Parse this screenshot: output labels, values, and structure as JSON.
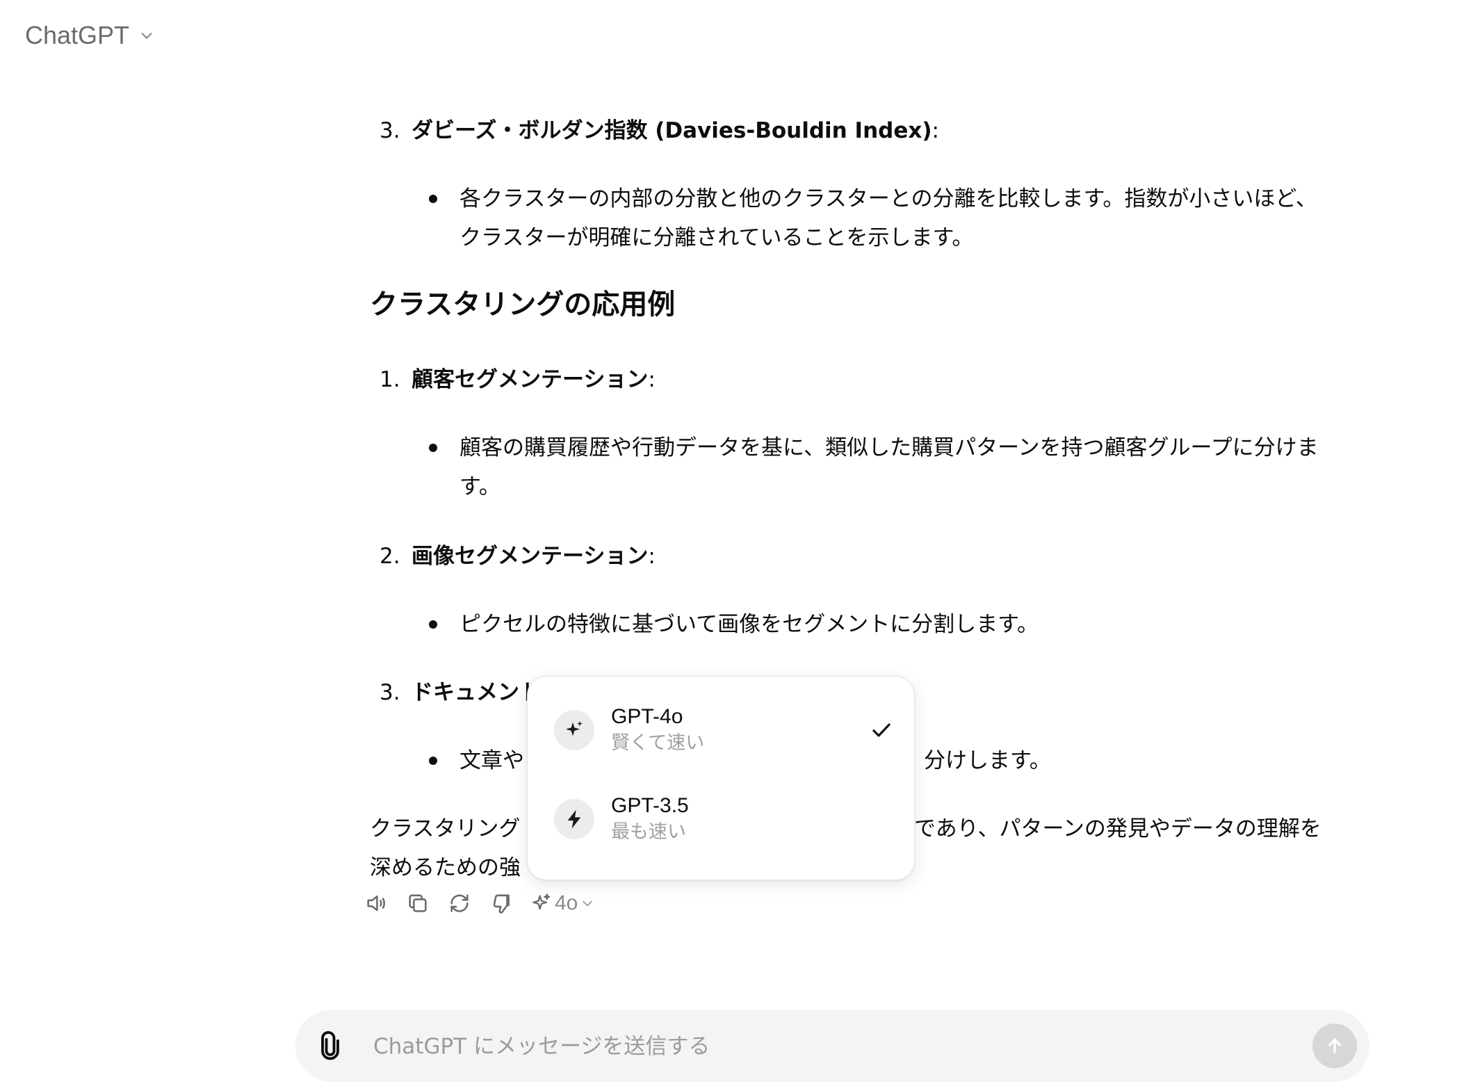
{
  "header": {
    "title": "ChatGPT"
  },
  "message": {
    "item_eval_3": {
      "num": "3.",
      "title": "ダビーズ・ボルダン指数 (Davies-Bouldin Index)",
      "suffix": ":"
    },
    "item_eval_3_bullet_line1": "各クラスターの内部の分散と他のクラスターとの分離を比較します。指数が小さいほど、",
    "item_eval_3_bullet_line2": "クラスターが明確に分離されていることを示します。",
    "heading": "クラスタリングの応用例",
    "app_1": {
      "num": "1.",
      "title": "顧客セグメンテーション",
      "suffix": ":"
    },
    "app_1_bullet_line1": "顧客の購買履歴や行動データを基に、類似した購買パターンを持つ顧客グループに分けま",
    "app_1_bullet_line2": "す。",
    "app_2": {
      "num": "2.",
      "title": "画像セグメンテーション",
      "suffix": ":"
    },
    "app_2_bullet": "ピクセルの特徴に基づいて画像をセグメントに分割します。",
    "app_3": {
      "num": "3.",
      "title": "ドキュメントクラスタリング",
      "suffix": ":"
    },
    "app_3_bullet_start": "文章や",
    "app_3_bullet_end": "分けします。",
    "conclusion_line1_start": "クラスタリング",
    "conclusion_line1_end": "能であり、パターンの発見やデータの理解を",
    "conclusion_line2_start": "深めるための強"
  },
  "actions": {
    "model_label": "4o",
    "icons": [
      "speaker-icon",
      "copy-icon",
      "regenerate-icon",
      "thumbs-down-icon",
      "sparkle-icon"
    ]
  },
  "model_menu": {
    "items": [
      {
        "name": "GPT-4o",
        "desc": "賢くて速い",
        "icon": "sparkle-icon",
        "selected": true
      },
      {
        "name": "GPT-3.5",
        "desc": "最も速い",
        "icon": "lightning-icon",
        "selected": false
      }
    ]
  },
  "composer": {
    "placeholder": "ChatGPT にメッセージを送信する"
  }
}
